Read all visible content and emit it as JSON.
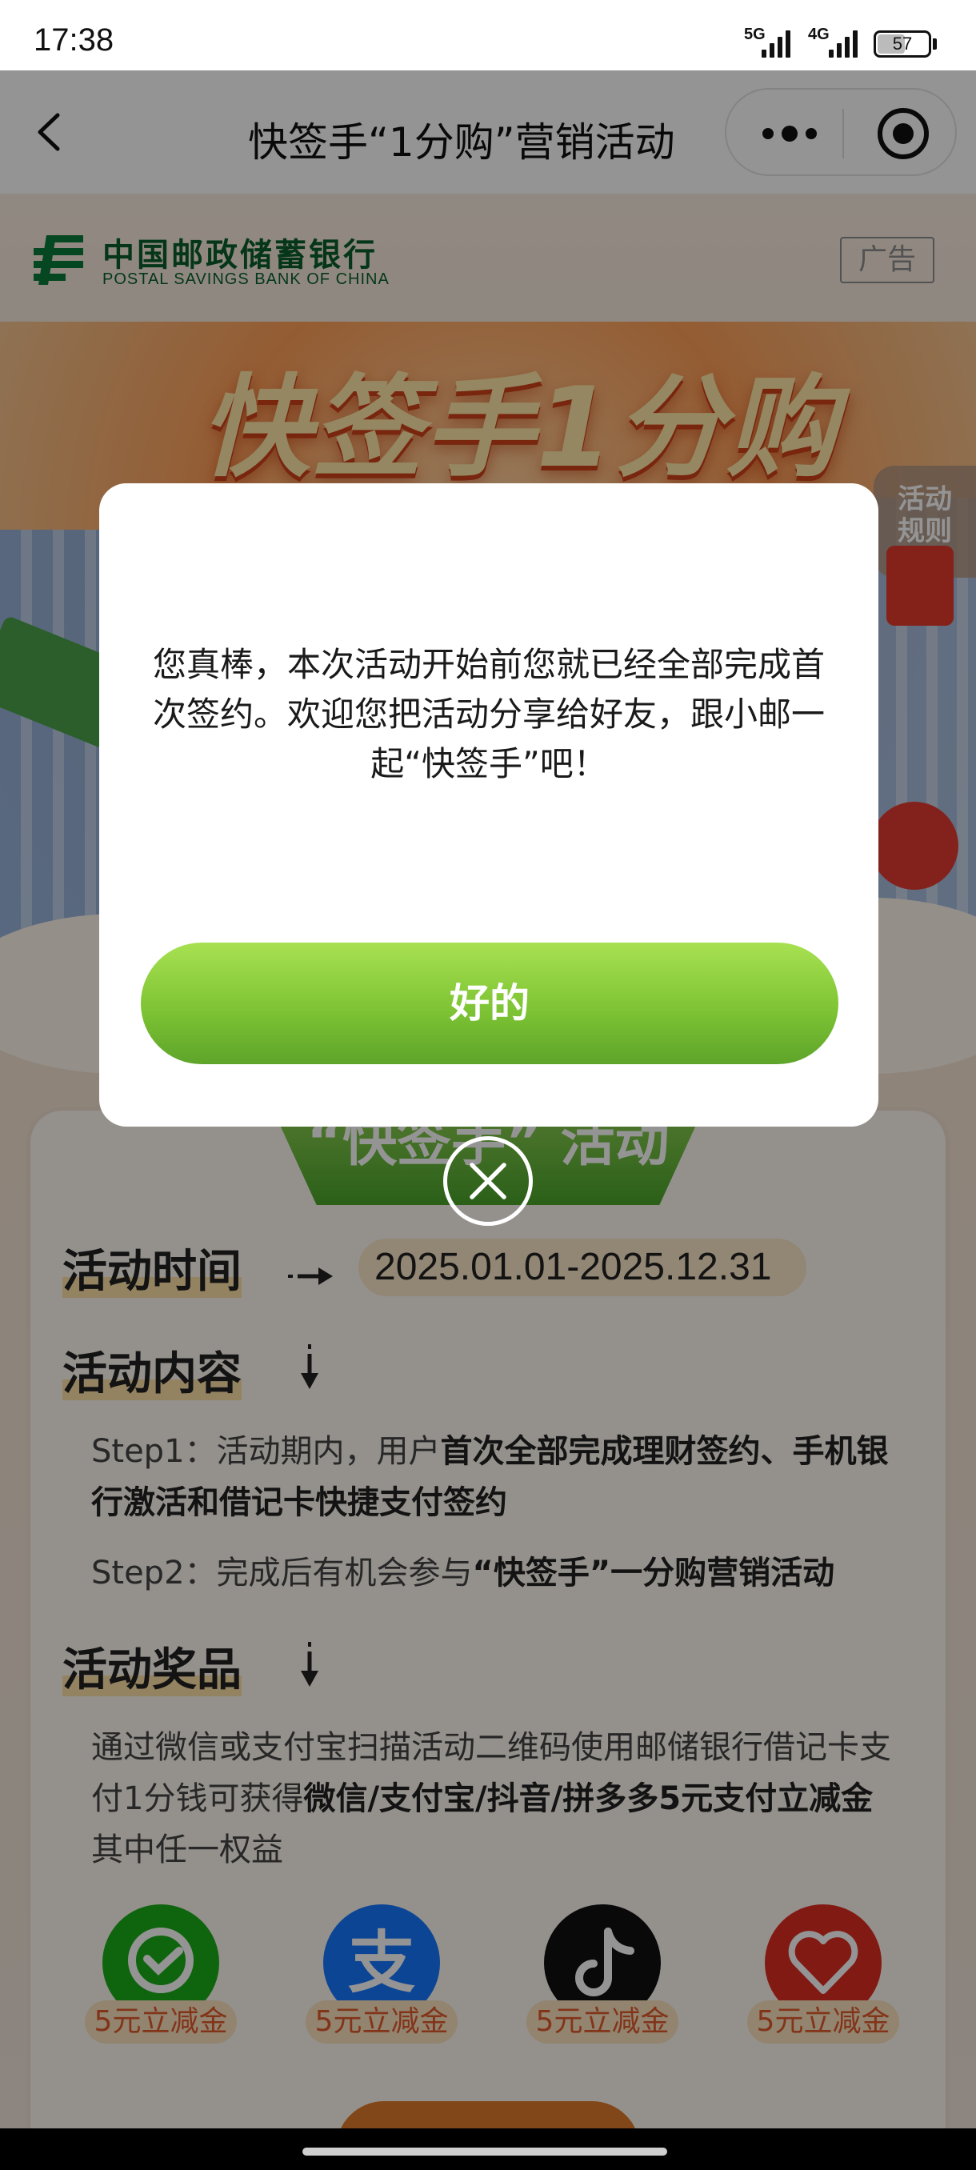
{
  "status_bar": {
    "time": "17:38",
    "network1": "5G",
    "network2": "4G",
    "battery": "57"
  },
  "nav": {
    "title": "快签手“1分购”营销活动",
    "back_icon": "chevron-left-icon",
    "more_icon": "more-dots-icon",
    "close_icon": "target-circle-icon"
  },
  "header": {
    "bank_name_cn": "中国邮政储蓄银行",
    "bank_name_en": "POSTAL SAVINGS BANK OF CHINA",
    "ad_tag": "广告"
  },
  "banner": {
    "headline": "快签手1分购",
    "rules_tab": "活动\n规则"
  },
  "card": {
    "title": "“快签手” 活动",
    "time_heading": "活动时间",
    "time_value": "2025.01.01-2025.12.31",
    "content_heading": "活动内容",
    "step1_prefix": "Step1：活动期内，用户",
    "step1_em1": "首次全部完成理财签约、手机银行激活和借记卡快捷支付签约",
    "step2_prefix": "Step2：完成后有机会参与",
    "step2_em": "“快签手”一分购营销活动",
    "prize_heading": "活动奖品",
    "prize_text_prefix": "通过微信或支付宝扫描活动二维码使用邮储银行借记卡支付1分钱可获得",
    "prize_text_em": "微信/支付宝/抖音/拼多多5元支付立减金",
    "prize_text_suffix": "其中任一权益",
    "prizes": [
      {
        "icon": "wechat-pay-icon",
        "label": "5元立减金",
        "color": "#1aad19"
      },
      {
        "icon": "alipay-icon",
        "label": "5元立减金",
        "color": "#1677ff"
      },
      {
        "icon": "douyin-icon",
        "label": "5元立减金",
        "color": "#111111"
      },
      {
        "icon": "pinduoduo-icon",
        "label": "5元立减金",
        "color": "#e02e24"
      }
    ]
  },
  "dialog": {
    "message": "您真棒，本次活动开始前您就已经全部完成首次签约。欢迎您把活动分享给好友，跟小邮一起“快签手”吧！",
    "ok_label": "好的",
    "close_icon": "close-circle-icon"
  },
  "colors": {
    "accent_green": "#7ec434",
    "bank_green": "#0a5e2e",
    "prize_orange": "#e05a2b"
  }
}
